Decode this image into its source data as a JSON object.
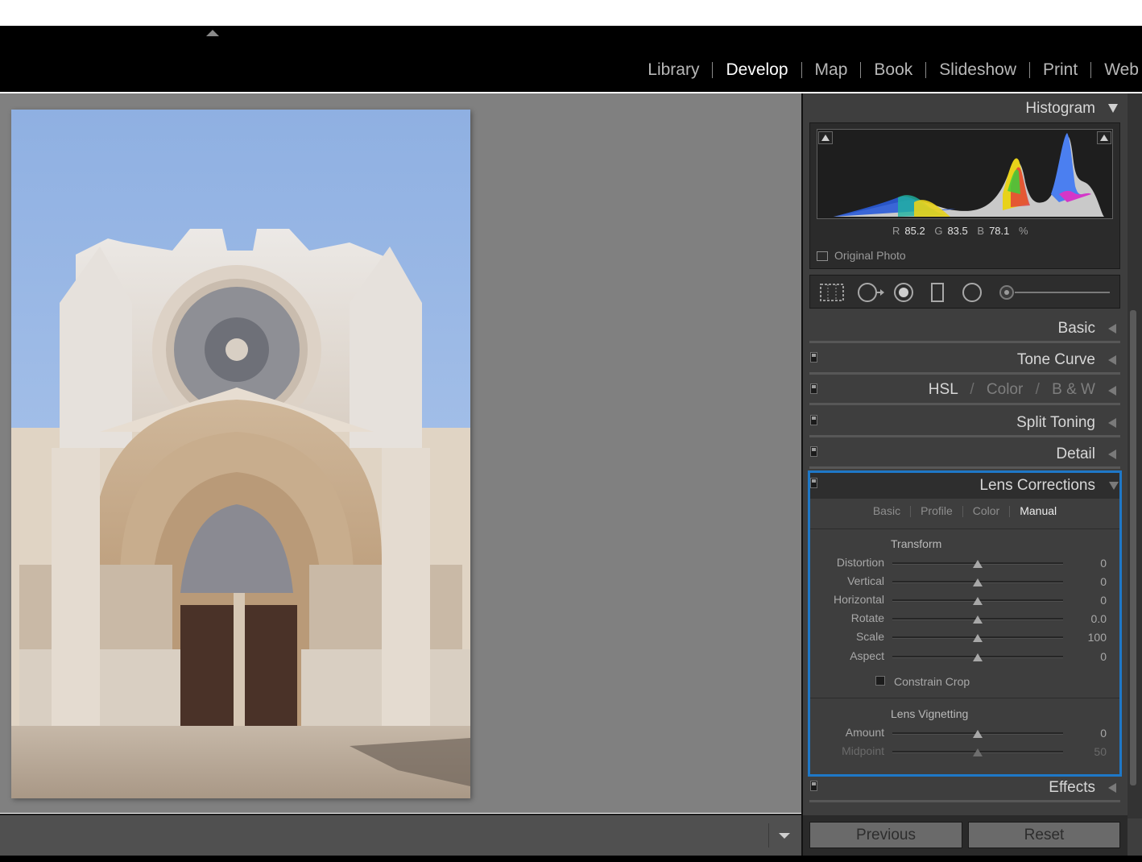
{
  "modules": [
    "Library",
    "Develop",
    "Map",
    "Book",
    "Slideshow",
    "Print",
    "Web"
  ],
  "active_module": "Develop",
  "histogram": {
    "title": "Histogram",
    "r_label": "R",
    "r_value": "85.2",
    "g_label": "G",
    "g_value": "83.5",
    "b_label": "B",
    "b_value": "78.1",
    "unit": "%",
    "original_photo_label": "Original Photo"
  },
  "panels": {
    "basic": "Basic",
    "tone_curve": "Tone Curve",
    "hsl": "HSL",
    "color": "Color",
    "bw": "B & W",
    "split_toning": "Split Toning",
    "detail": "Detail",
    "lens_corrections": "Lens Corrections",
    "effects": "Effects"
  },
  "lens_tabs": [
    "Basic",
    "Profile",
    "Color",
    "Manual"
  ],
  "lens_active_tab": "Manual",
  "transform": {
    "title": "Transform",
    "sliders": [
      {
        "label": "Distortion",
        "value": "0"
      },
      {
        "label": "Vertical",
        "value": "0"
      },
      {
        "label": "Horizontal",
        "value": "0"
      },
      {
        "label": "Rotate",
        "value": "0.0"
      },
      {
        "label": "Scale",
        "value": "100"
      },
      {
        "label": "Aspect",
        "value": "0"
      }
    ],
    "constrain_crop": "Constrain Crop"
  },
  "vignetting": {
    "title": "Lens Vignetting",
    "sliders": [
      {
        "label": "Amount",
        "value": "0"
      },
      {
        "label": "Midpoint",
        "value": "50"
      }
    ]
  },
  "buttons": {
    "previous": "Previous",
    "reset": "Reset"
  },
  "colors": {
    "accent_outline": "#1e78c8",
    "panel_bg": "#3e3e3e",
    "canvas_bg": "#808080"
  }
}
